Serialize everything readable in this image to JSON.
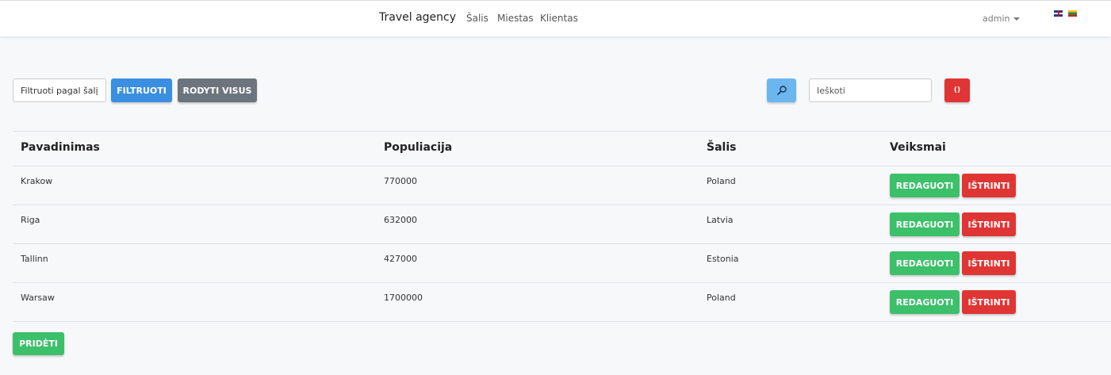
{
  "navbar": {
    "brand": "Travel agency",
    "links": [
      "Šalis",
      "Miestas",
      "Klientas"
    ],
    "user": "admin",
    "languages": [
      "gb-flag-icon",
      "lt-flag-icon"
    ]
  },
  "toolbar": {
    "filter_placeholder": "Filtruoti pagal šalį",
    "filter_label": "Filtruoti",
    "show_all_label": "Rodyti visus",
    "search_icon": "search-icon",
    "search_placeholder": "Ieškoti",
    "reset_label": "()"
  },
  "table": {
    "headers": [
      "Pavadinimas",
      "Populiacija",
      "Šalis",
      "Veiksmai"
    ],
    "rows": [
      {
        "name": "Krakow",
        "population": "770000",
        "country": "Poland"
      },
      {
        "name": "Riga",
        "population": "632000",
        "country": "Latvia"
      },
      {
        "name": "Tallinn",
        "population": "427000",
        "country": "Estonia"
      },
      {
        "name": "Warsaw",
        "population": "1700000",
        "country": "Poland"
      }
    ],
    "edit_label": "Redaguoti",
    "delete_label": "Ištrinti"
  },
  "add_label": "Pridėti",
  "colors": {
    "primary": "#3a8fe0",
    "secondary": "#6c757d",
    "success": "#3cc06a",
    "danger": "#e03535",
    "info": "#6cb6f0"
  }
}
